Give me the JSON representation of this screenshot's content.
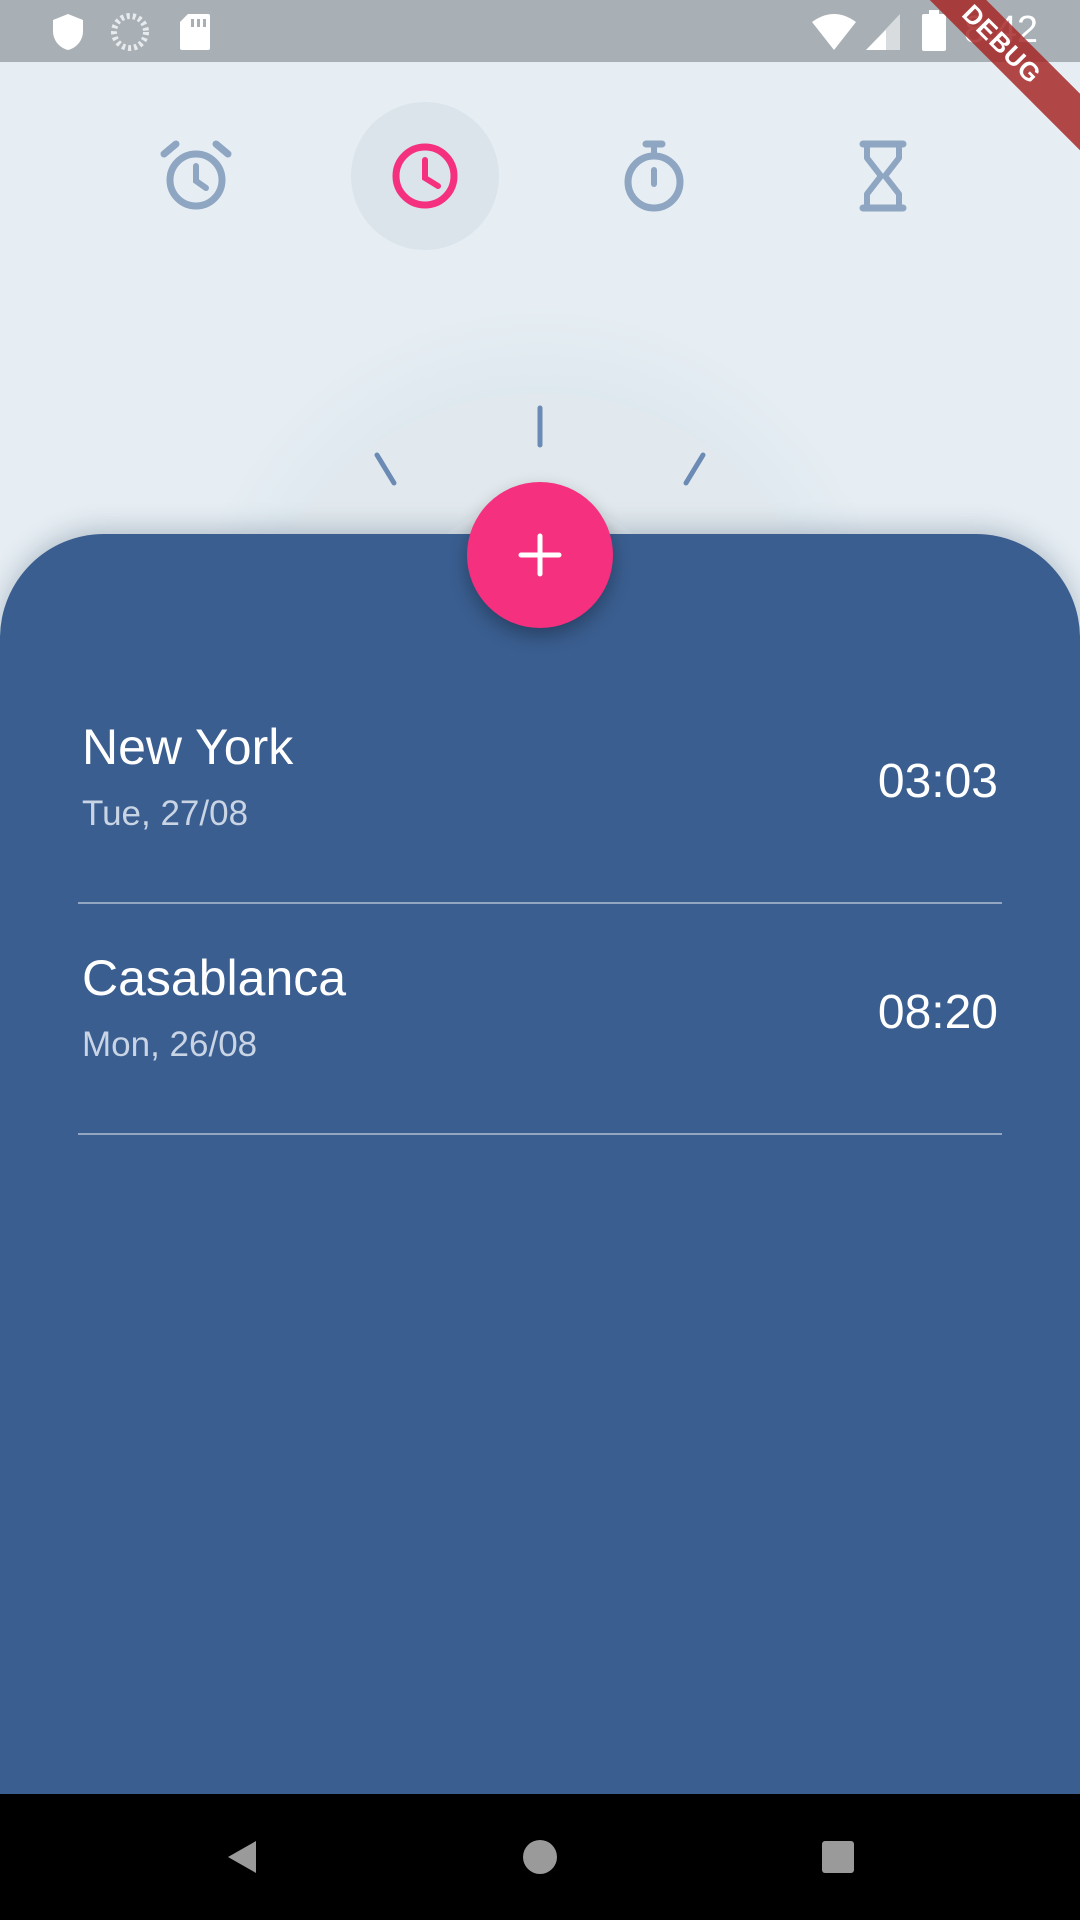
{
  "status_bar": {
    "time": "8:42",
    "icons": [
      "shield-icon",
      "loading-icon",
      "sd-card-icon",
      "wifi-icon",
      "signal-icon",
      "battery-icon"
    ],
    "debug_label": "DEBUG"
  },
  "tabs": [
    {
      "name": "alarm",
      "icon": "alarm-icon",
      "active": false
    },
    {
      "name": "world-clock",
      "icon": "clock-icon",
      "active": true
    },
    {
      "name": "stopwatch",
      "icon": "stopwatch-icon",
      "active": false
    },
    {
      "name": "timer",
      "icon": "hourglass-icon",
      "active": false
    }
  ],
  "fab": {
    "icon": "plus-icon"
  },
  "cities": [
    {
      "name": "New York",
      "date": "Tue, 27/08",
      "time": "03:03"
    },
    {
      "name": "Casablanca",
      "date": "Mon, 26/08",
      "time": "08:20"
    }
  ],
  "colors": {
    "accent": "#f4307f",
    "sheet": "#3a5e90",
    "background": "#e6eef3",
    "icon_inactive": "#8fa6c3"
  },
  "nav_bar": {
    "icons": [
      "back-icon",
      "home-icon",
      "recents-icon"
    ]
  }
}
